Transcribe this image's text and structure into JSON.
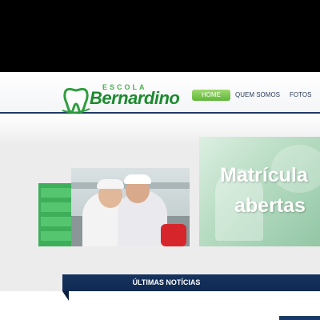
{
  "header": {
    "logo": {
      "small_text": "ESCOLA",
      "name": "Bernardino"
    },
    "nav": [
      {
        "label": "HOME"
      },
      {
        "label": "QUEM SOMOS"
      },
      {
        "label": "FOTOS"
      }
    ]
  },
  "banner": {
    "line1": "Matrícula",
    "line2": "abertas"
  },
  "news": {
    "title": "ÚLTIMAS NOTÍCIAS"
  },
  "colors": {
    "brand_green": "#1b8a2e",
    "nav_active": "#5fb63a",
    "navy": "#16335f"
  }
}
